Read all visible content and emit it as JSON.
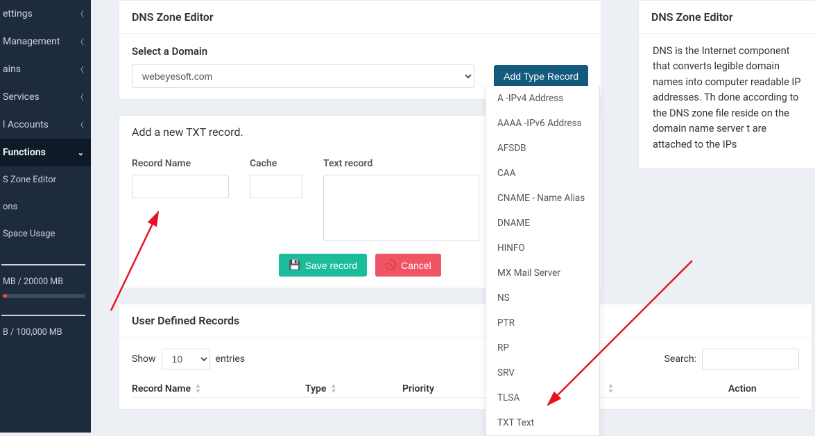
{
  "sidebar": {
    "items": [
      {
        "label": "ettings"
      },
      {
        "label": "Management"
      },
      {
        "label": "ains"
      },
      {
        "label": "Services"
      },
      {
        "label": "l Accounts"
      },
      {
        "label": " Functions"
      }
    ],
    "subs": [
      "S Zone Editor",
      "ons",
      "Space Usage"
    ],
    "stat1": " MB / 20000 MB",
    "stat2": "B / 100,000 MB"
  },
  "panel1": {
    "title": "DNS Zone Editor",
    "select_label": "Select a Domain",
    "domain_value": "webeyesoft.com",
    "add_btn": "Add Type Record"
  },
  "dropdown_items": [
    "A -IPv4 Address",
    "AAAA -IPv6 Address",
    "AFSDB",
    "CAA",
    "CNAME - Name Alias",
    "DNAME",
    "HINFO",
    "MX Mail Server",
    "NS",
    "PTR",
    "RP",
    "SRV",
    "TLSA",
    "TXT Text"
  ],
  "panel2": {
    "title": "Add a new TXT record.",
    "col1": "Record Name",
    "col2": "Cache",
    "col3": "Text record",
    "save": "Save record",
    "cancel": "Cancel"
  },
  "panel3": {
    "title": "User Defined Records",
    "show": "Show",
    "entries": "entries",
    "per_page": "10",
    "search": "Search:",
    "th1": "Record Name",
    "th2": "Type",
    "th3": "Priority",
    "th4": "Action"
  },
  "help": {
    "title": "DNS Zone Editor",
    "body": "DNS is the Internet component that converts legible domain names into computer readable IP addresses. Th done according to the DNS zone file reside on the domain name server t are attached to the IPs"
  }
}
